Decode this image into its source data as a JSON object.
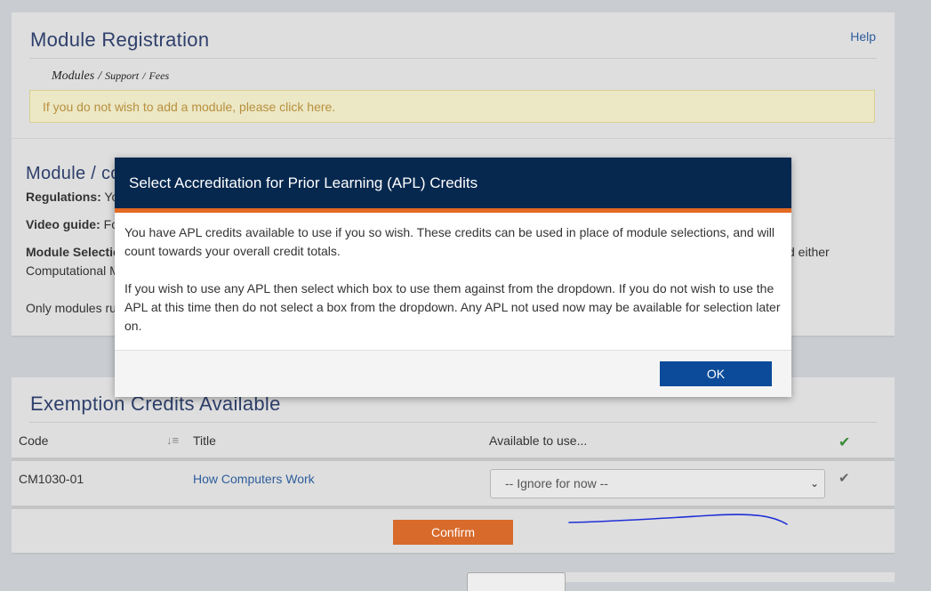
{
  "registration": {
    "title": "Module Registration",
    "help": "Help",
    "breadcrumb": {
      "modules": "Modules",
      "sep": "/",
      "support": "Support",
      "sep2": "/",
      "fees": "Fees"
    },
    "notice": "If you do not wish to add a module, please click here."
  },
  "module_section": {
    "title": "Module / co",
    "regulations_label": "Regulations:",
    "regulations_text": "Yo",
    "video_label": "Video guide:",
    "video_text": "Fo",
    "selection_label": "Module Selectio",
    "selection_trailing": "d either",
    "computational": "Computational M",
    "only_modules": "Only modules ru"
  },
  "exemption": {
    "title": "Exemption Credits Available",
    "columns": {
      "code": "Code",
      "sort_icon": "↓≡",
      "title": "Title",
      "available": "Available to use...",
      "check": "✔"
    },
    "rows": [
      {
        "code": "CM1030-01",
        "title": "How Computers Work",
        "select_value": "-- Ignore for now --",
        "check": "✔"
      }
    ],
    "confirm": "Confirm"
  },
  "modal": {
    "title": "Select Accreditation for Prior Learning (APL) Credits",
    "para1": "You have APL credits available to use if you so wish. These credits can be used in place of module selections, and will count towards your overall credit totals.",
    "para2": "If you wish to use any APL then select which box to use them against from the dropdown. If you do not wish to use the APL at this time then do not select a box from the dropdown. Any APL not used now may be available for selection later on.",
    "ok": "OK"
  },
  "colors": {
    "modal_header": "#06284f",
    "accent_orange": "#e26a22",
    "ok_button": "#0b4b9a",
    "confirm_button": "#d86a2b",
    "check_green": "#3a8a3a",
    "annotation_blue": "#1f2fd6"
  }
}
